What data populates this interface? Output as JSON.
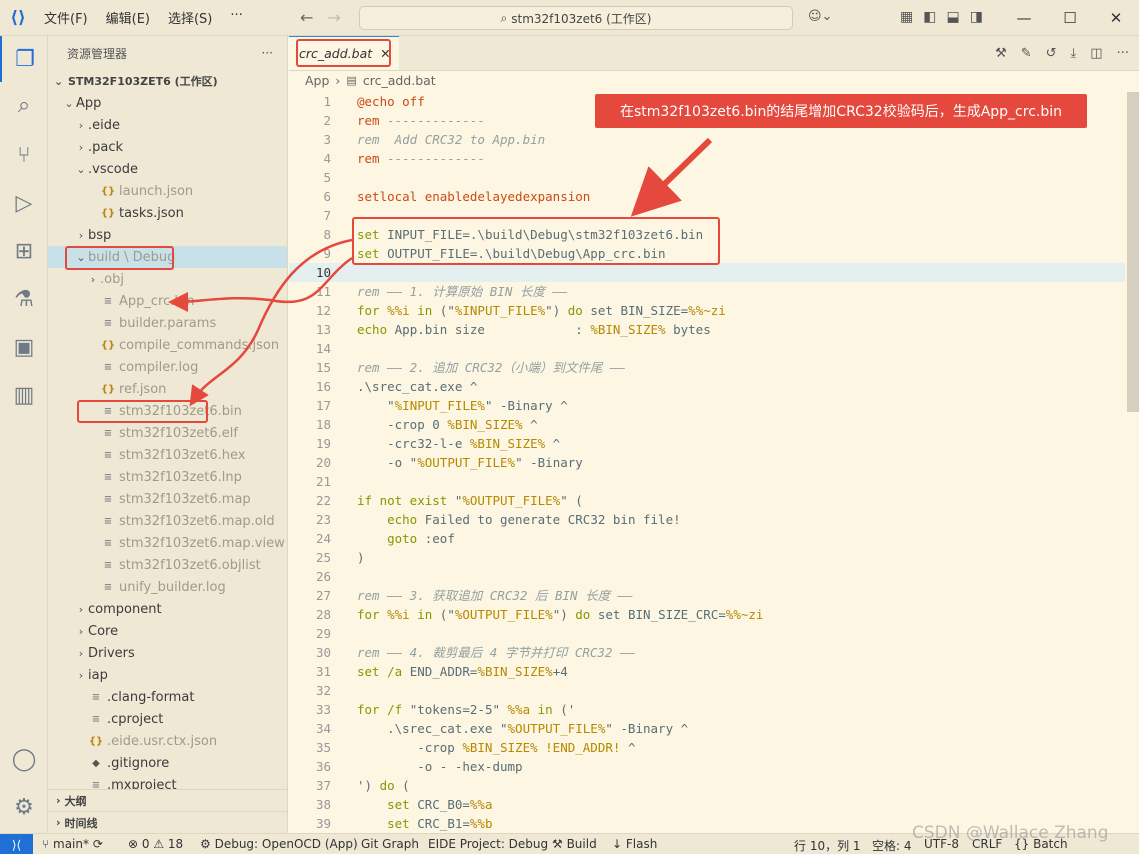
{
  "titlebar": {
    "menu": [
      "文件(F)",
      "编辑(E)",
      "选择(S)",
      "···"
    ],
    "search": "stm32f103zet6 (工作区)"
  },
  "sidebar": {
    "title": "资源管理器",
    "more": "···",
    "project": "STM32F103ZET6 (工作区)",
    "tree": [
      {
        "label": "App",
        "chev": "⌄",
        "depth": 0,
        "icon": ""
      },
      {
        "label": ".eide",
        "chev": "›",
        "depth": 1,
        "icon": ""
      },
      {
        "label": ".pack",
        "chev": "›",
        "depth": 1,
        "icon": ""
      },
      {
        "label": ".vscode",
        "chev": "⌄",
        "depth": 1,
        "icon": ""
      },
      {
        "label": "launch.json",
        "chev": "",
        "depth": 2,
        "icon": "{}",
        "dim": true
      },
      {
        "label": "tasks.json",
        "chev": "",
        "depth": 2,
        "icon": "{}"
      },
      {
        "label": "bsp",
        "chev": "›",
        "depth": 1,
        "icon": ""
      },
      {
        "label": "build \\ Debug",
        "chev": "⌄",
        "depth": 1,
        "icon": "",
        "sel": true,
        "dim": true
      },
      {
        "label": ".obj",
        "chev": "›",
        "depth": 2,
        "icon": "",
        "dim": true
      },
      {
        "label": "App_crc.bin",
        "chev": "",
        "depth": 2,
        "icon": "≡",
        "dim": true
      },
      {
        "label": "builder.params",
        "chev": "",
        "depth": 2,
        "icon": "≡",
        "dim": true
      },
      {
        "label": "compile_commands.json",
        "chev": "",
        "depth": 2,
        "icon": "{}",
        "dim": true
      },
      {
        "label": "compiler.log",
        "chev": "",
        "depth": 2,
        "icon": "≡",
        "dim": true
      },
      {
        "label": "ref.json",
        "chev": "",
        "depth": 2,
        "icon": "{}",
        "dim": true
      },
      {
        "label": "stm32f103zet6.bin",
        "chev": "",
        "depth": 2,
        "icon": "≡",
        "dim": true
      },
      {
        "label": "stm32f103zet6.elf",
        "chev": "",
        "depth": 2,
        "icon": "≡",
        "dim": true
      },
      {
        "label": "stm32f103zet6.hex",
        "chev": "",
        "depth": 2,
        "icon": "≡",
        "dim": true
      },
      {
        "label": "stm32f103zet6.lnp",
        "chev": "",
        "depth": 2,
        "icon": "≡",
        "dim": true
      },
      {
        "label": "stm32f103zet6.map",
        "chev": "",
        "depth": 2,
        "icon": "≡",
        "dim": true
      },
      {
        "label": "stm32f103zet6.map.old",
        "chev": "",
        "depth": 2,
        "icon": "≡",
        "dim": true
      },
      {
        "label": "stm32f103zet6.map.view",
        "chev": "",
        "depth": 2,
        "icon": "≡",
        "dim": true
      },
      {
        "label": "stm32f103zet6.objlist",
        "chev": "",
        "depth": 2,
        "icon": "≡",
        "dim": true
      },
      {
        "label": "unify_builder.log",
        "chev": "",
        "depth": 2,
        "icon": "≡",
        "dim": true
      },
      {
        "label": "component",
        "chev": "›",
        "depth": 1,
        "icon": ""
      },
      {
        "label": "Core",
        "chev": "›",
        "depth": 1,
        "icon": ""
      },
      {
        "label": "Drivers",
        "chev": "›",
        "depth": 1,
        "icon": ""
      },
      {
        "label": "iap",
        "chev": "›",
        "depth": 1,
        "icon": ""
      },
      {
        "label": ".clang-format",
        "chev": "",
        "depth": 1,
        "icon": "≡"
      },
      {
        "label": ".cproject",
        "chev": "",
        "depth": 1,
        "icon": "≡"
      },
      {
        "label": ".eide.usr.ctx.json",
        "chev": "",
        "depth": 1,
        "icon": "{}",
        "dim": true
      },
      {
        "label": ".gitignore",
        "chev": "",
        "depth": 1,
        "icon": "◆"
      },
      {
        "label": ".mxproject",
        "chev": "",
        "depth": 1,
        "icon": "≡"
      }
    ],
    "outline": "大纲",
    "timeline": "时间线"
  },
  "editor": {
    "tab": "crc_add.bat",
    "breadcrumb": [
      "App",
      "crc_add.bat"
    ],
    "callout": "在stm32f103zet6.bin的结尾增加CRC32校验码后，生成App_crc.bin",
    "lines": [
      [
        "@echo off",
        "k"
      ],
      [
        "rem -------------",
        "k"
      ],
      [
        "rem  Add CRC32 to App.bin",
        "c"
      ],
      [
        "rem -------------",
        "k"
      ],
      [
        "",
        ""
      ],
      [
        "setlocal enabledelayedexpansion",
        "k"
      ],
      [
        "",
        ""
      ],
      [
        "set INPUT_FILE=.\\build\\Debug\\stm32f103zet6.bin",
        "set"
      ],
      [
        "set OUTPUT_FILE=.\\build\\Debug\\App_crc.bin",
        "set"
      ],
      [
        "",
        ""
      ],
      [
        "rem —— 1. 计算原始 BIN 长度 ——",
        "c"
      ],
      [
        "for %%i in (\"%INPUT_FILE%\") do set BIN_SIZE=%%~zi",
        "for"
      ],
      [
        "echo App.bin size            : %BIN_SIZE% bytes",
        "echo"
      ],
      [
        "",
        ""
      ],
      [
        "rem —— 2. 追加 CRC32（小端）到文件尾 ——",
        "c"
      ],
      [
        ".\\srec_cat.exe ^",
        ""
      ],
      [
        "    \"%INPUT_FILE%\" -Binary ^",
        "str"
      ],
      [
        "    -crop 0 %BIN_SIZE% ^",
        ""
      ],
      [
        "    -crc32-l-e %BIN_SIZE% ^",
        ""
      ],
      [
        "    -o \"%OUTPUT_FILE%\" -Binary",
        ""
      ],
      [
        "",
        ""
      ],
      [
        "if not exist \"%OUTPUT_FILE%\" (",
        "kw"
      ],
      [
        "    echo Failed to generate CRC32 bin file!",
        "echo"
      ],
      [
        "    goto :eof",
        "kw"
      ],
      [
        ")",
        ""
      ],
      [
        "",
        ""
      ],
      [
        "rem —— 3. 获取追加 CRC32 后 BIN 长度 ——",
        "c"
      ],
      [
        "for %%i in (\"%OUTPUT_FILE%\") do set BIN_SIZE_CRC=%%~zi",
        "for"
      ],
      [
        "",
        ""
      ],
      [
        "rem —— 4. 裁剪最后 4 字节并打印 CRC32 ——",
        "c"
      ],
      [
        "set /a END_ADDR=%BIN_SIZE%+4",
        "set"
      ],
      [
        "",
        ""
      ],
      [
        "for /f \"tokens=2-5\" %%a in ('",
        "for"
      ],
      [
        "    .\\srec_cat.exe \"%OUTPUT_FILE%\" -Binary ^",
        ""
      ],
      [
        "        -crop %BIN_SIZE% !END_ADDR! ^",
        ""
      ],
      [
        "        -o - -hex-dump",
        ""
      ],
      [
        "') do (",
        "kw"
      ],
      [
        "    set CRC_B0=%%a",
        "set"
      ],
      [
        "    set CRC_B1=%%b",
        "set"
      ]
    ]
  },
  "status": {
    "branch": "main*",
    "problems": "⊗ 0 ⚠ 18",
    "debug": "Debug: OpenOCD (App)",
    "gitgraph": "Git Graph",
    "eide": "EIDE Project: Debug",
    "build": "Build",
    "flash": "Flash",
    "position": "行 10，列 1",
    "spaces": "空格: 4",
    "encoding": "UTF-8",
    "eol": "CRLF",
    "lang": "Batch",
    "watermark": "CSDN @Wallace Zhang"
  }
}
